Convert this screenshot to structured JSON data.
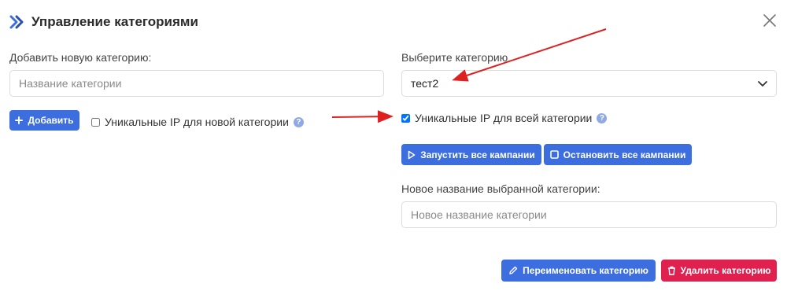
{
  "dialog": {
    "title": "Управление категориями",
    "close_icon": "close-icon",
    "title_icon": "double-chevron-right-icon"
  },
  "left": {
    "add_label": "Добавить новую категорию:",
    "name_placeholder": "Название категории",
    "name_value": "",
    "add_button": "Добавить",
    "unique_ip_label": "Уникальные IP для новой категории",
    "unique_ip_checked": false,
    "help": "?"
  },
  "right": {
    "select_label": "Выберите категорию",
    "selected_category": "тест2",
    "unique_ip_label": "Уникальные IP для всей категории",
    "unique_ip_checked": true,
    "help": "?",
    "start_all_button": "Запустить все кампании",
    "stop_all_button": "Остановить все кампании",
    "rename_label": "Новое название выбранной категории:",
    "rename_placeholder": "Новое название категории",
    "rename_value": "",
    "rename_button": "Переименовать категорию",
    "delete_button": "Удалить категорию"
  },
  "colors": {
    "primary": "#3d6ee0",
    "danger": "#e0204f",
    "annotation_arrow": "#e02020"
  }
}
